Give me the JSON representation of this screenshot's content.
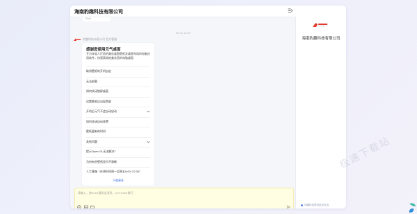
{
  "chat": {
    "title": "海南豹趣科技有限公司",
    "top_cut_text": "Shell",
    "timestamp": "05-31 18:09",
    "sender": "豹趣科技有限公司 官方客服",
    "card": {
      "title": "感谢您使用元气桌面",
      "subtitle": "专为年轻人打造的美化桌面壁纸及桌面布局的电脑应用软件，快速高效地美化您的电脑桌面",
      "faq": [
        {
          "label": "取消壁纸的开机自启",
          "expandable": false
        },
        {
          "label": "无法卸载",
          "expandable": false
        },
        {
          "label": "如何关闭锁屏桌面",
          "expandable": false
        },
        {
          "label": "设置壁纸后出现黑屏",
          "expandable": false
        },
        {
          "label": "开机后元气不会自动启动",
          "expandable": true
        },
        {
          "label": "如何关闭自动续费",
          "expandable": false
        },
        {
          "label": "壁纸更新的时间",
          "expandable": false
        },
        {
          "label": "其他问题",
          "expandable": true
        },
        {
          "label": "提示Open GL无法解决？",
          "expandable": false
        },
        {
          "label": "为何有些壁纸显示不清晰",
          "expandable": false
        },
        {
          "label": "人工客服（在线时间周一至周五9:00~22:30）",
          "expandable": false
        }
      ],
      "more_label": "下载更多"
    },
    "input_placeholder": "请输入，按Enter键发送消息，Ctrl+Enter换行",
    "tools": [
      "emoji-icon",
      "screenshot-icon",
      "folder-icon"
    ],
    "send_icon": "send-icon"
  },
  "side": {
    "company_name": "海南豹趣科技有限公司",
    "footer": "豹趣科技提供技术支持"
  },
  "watermark": "极速下载站",
  "colors": {
    "accent": "#3d6ce7",
    "input_bg": "#fffde2",
    "logo_red": "#e23b2e"
  }
}
